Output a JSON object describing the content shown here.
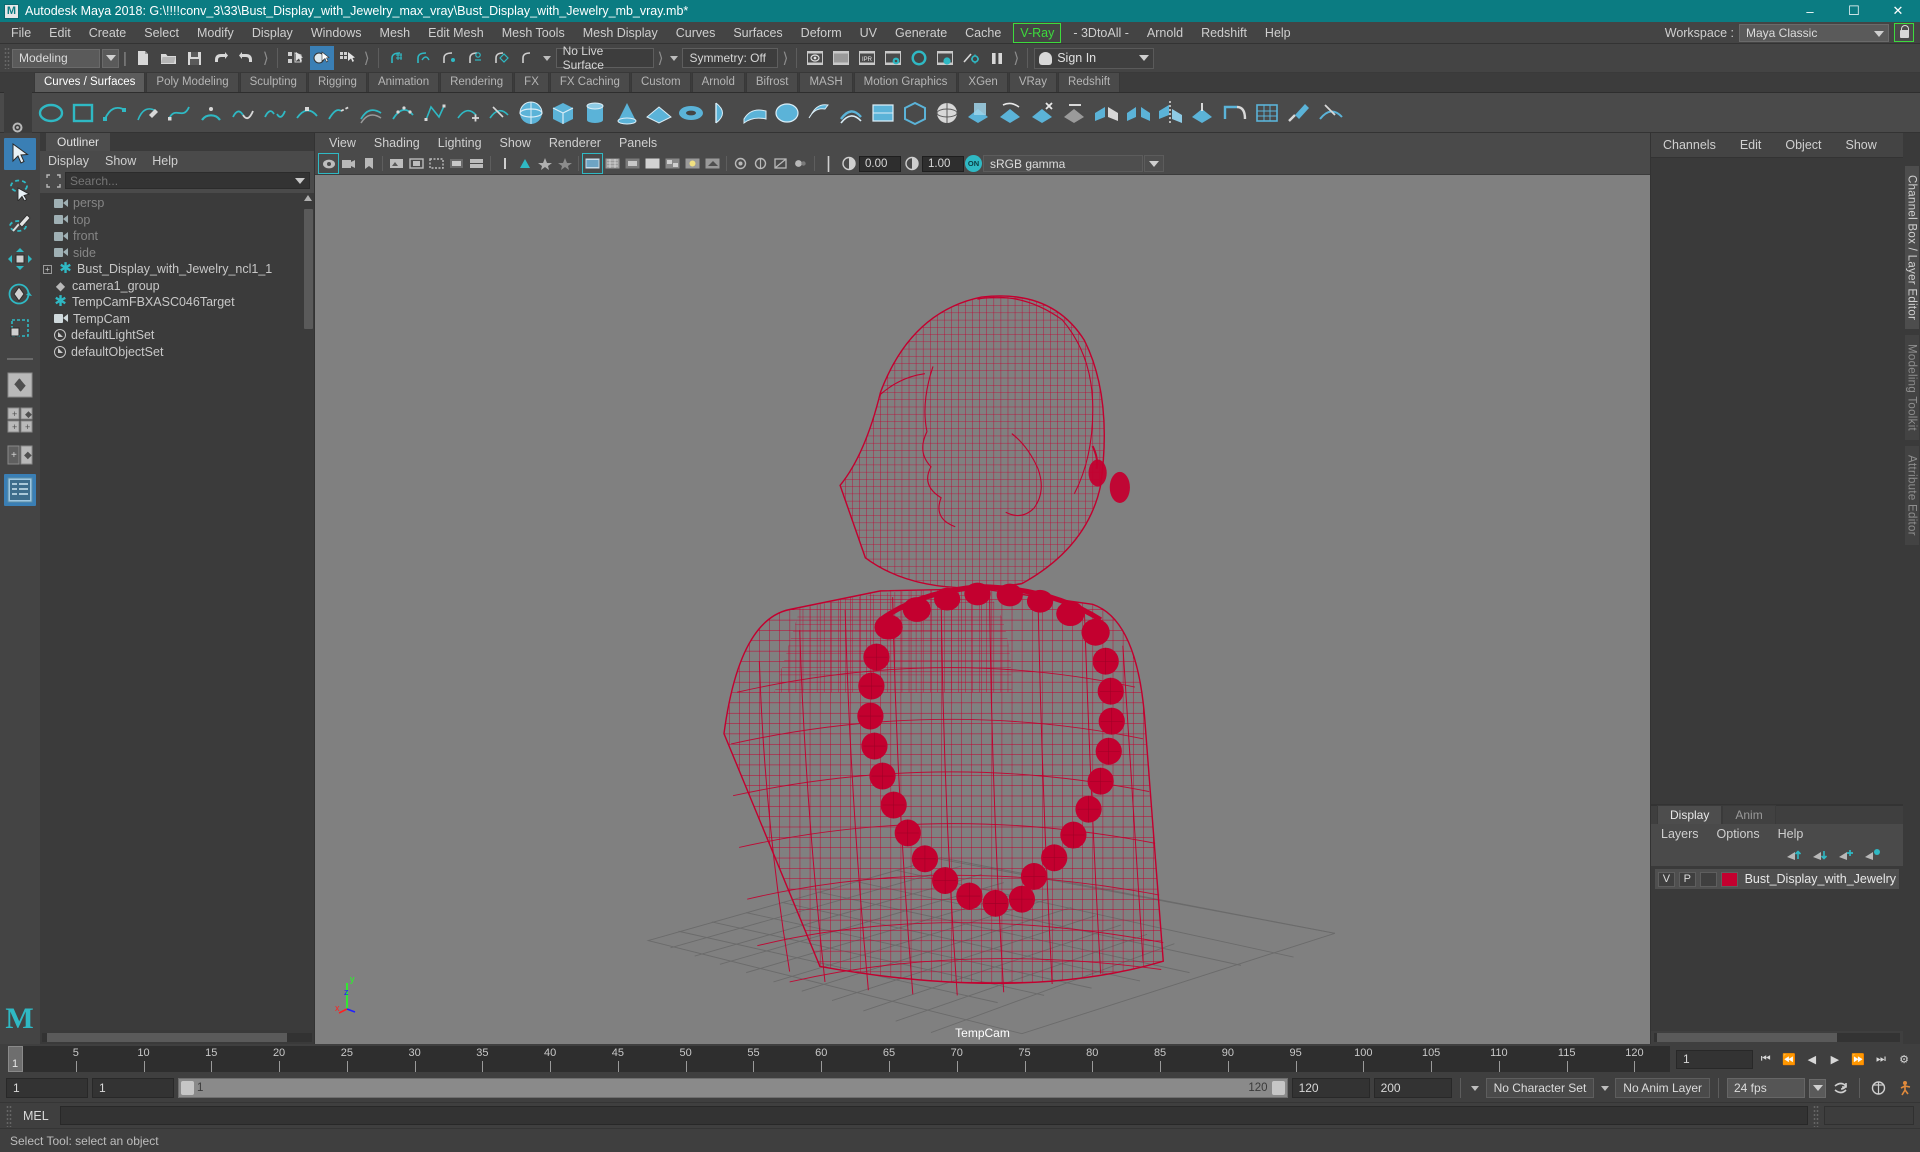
{
  "window": {
    "title": "Autodesk Maya 2018: G:\\!!!!conv_3\\33\\Bust_Display_with_Jewelry_max_vray\\Bust_Display_with_Jewelry_mb_vray.mb*",
    "logo_text": "M",
    "minimize": "–",
    "maximize": "☐",
    "close": "✕"
  },
  "menubar": {
    "items": [
      "File",
      "Edit",
      "Create",
      "Select",
      "Modify",
      "Display",
      "Windows",
      "Mesh",
      "Edit Mesh",
      "Mesh Tools",
      "Mesh Display",
      "Curves",
      "Surfaces",
      "Deform",
      "UV",
      "Generate",
      "Cache"
    ],
    "vray": "V-Ray",
    "after_vray": [
      "- 3DtoAll -",
      "Arnold",
      "Redshift",
      "Help"
    ],
    "workspace_label": "Workspace :",
    "workspace_value": "Maya Classic",
    "lock_icon": "lock-icon",
    "vray_color": "#3ddb3d"
  },
  "statusline": {
    "menu_set": "Modeling",
    "live_surface": "No Live Surface",
    "symmetry": "Symmetry: Off",
    "sign_in": "Sign In"
  },
  "shelf": {
    "tabs": [
      "Curves / Surfaces",
      "Poly Modeling",
      "Sculpting",
      "Rigging",
      "Animation",
      "Rendering",
      "FX",
      "FX Caching",
      "Custom",
      "Arnold",
      "Bifrost",
      "MASH",
      "Motion Graphics",
      "XGen",
      "VRay",
      "Redshift"
    ],
    "active_tab": "Curves / Surfaces"
  },
  "outliner": {
    "tab": "Outliner",
    "menu": [
      "Display",
      "Show",
      "Help"
    ],
    "search_placeholder": "Search...",
    "items": [
      {
        "label": "persp",
        "icon": "camera-icon",
        "dim": true,
        "expander": false
      },
      {
        "label": "top",
        "icon": "camera-icon",
        "dim": true,
        "expander": false
      },
      {
        "label": "front",
        "icon": "camera-icon",
        "dim": true,
        "expander": false
      },
      {
        "label": "side",
        "icon": "camera-icon",
        "dim": true,
        "expander": false
      },
      {
        "label": "Bust_Display_with_Jewelry_ncl1_1",
        "icon": "transform-icon",
        "dim": false,
        "expander": true
      },
      {
        "label": "camera1_group",
        "icon": "group-icon",
        "dim": false,
        "expander": false
      },
      {
        "label": "TempCamFBXASC046Target",
        "icon": "transform-icon",
        "dim": false,
        "expander": false
      },
      {
        "label": "TempCam",
        "icon": "camera-icon",
        "dim": false,
        "expander": false
      },
      {
        "label": "defaultLightSet",
        "icon": "set-icon",
        "dim": false,
        "expander": false
      },
      {
        "label": "defaultObjectSet",
        "icon": "set-icon",
        "dim": false,
        "expander": false
      }
    ]
  },
  "viewport": {
    "menu": [
      "View",
      "Shading",
      "Lighting",
      "Show",
      "Renderer",
      "Panels"
    ],
    "exposure": "0.00",
    "gamma": "1.00",
    "color_management": "sRGB gamma",
    "on_badge": "ON",
    "camera_label": "TempCam",
    "background_color": "#808080",
    "wireframe_color": "#c3002f",
    "grid_color": "#6e6e6e",
    "axis": {
      "x": "x",
      "y": "y",
      "z": "z",
      "x_color": "#ff2020",
      "y_color": "#20ff20",
      "z_color": "#2020ff"
    }
  },
  "channelbox": {
    "tabs": [
      "Channels",
      "Edit",
      "Object",
      "Show"
    ]
  },
  "layer_editor": {
    "tabs": [
      "Display",
      "Anim"
    ],
    "active_tab": "Display",
    "menu": [
      "Layers",
      "Options",
      "Help"
    ],
    "buttons": [
      "move-layer-up-icon",
      "move-layer-down-icon",
      "new-layer-icon",
      "new-layer-from-selected-icon"
    ],
    "layers": [
      {
        "visibility": "V",
        "playback": "P",
        "shading": "",
        "color": "#c3002f",
        "name": "Bust_Display_with_Jewelry"
      }
    ]
  },
  "vertical_tabs": [
    {
      "label": "Channel Box / Layer Editor",
      "active": true
    },
    {
      "label": "Modeling Toolkit",
      "active": false
    },
    {
      "label": "Attribute Editor",
      "active": false
    }
  ],
  "timeline": {
    "current_frame_marker": "1",
    "ticks": [
      5,
      10,
      15,
      20,
      25,
      30,
      35,
      40,
      45,
      50,
      55,
      60,
      65,
      70,
      75,
      80,
      85,
      90,
      95,
      100,
      105,
      110,
      115,
      120
    ],
    "current_frame_field": "1"
  },
  "range": {
    "start": "1",
    "end": "1",
    "range_start_label": "1",
    "range_end_label": "120",
    "anim_end": "120",
    "playback_end": "200",
    "character_set": "No Character Set",
    "anim_layer": "No Anim Layer",
    "fps": "24 fps"
  },
  "command": {
    "label": "MEL",
    "value": ""
  },
  "status": {
    "message": "Select Tool: select an object"
  }
}
